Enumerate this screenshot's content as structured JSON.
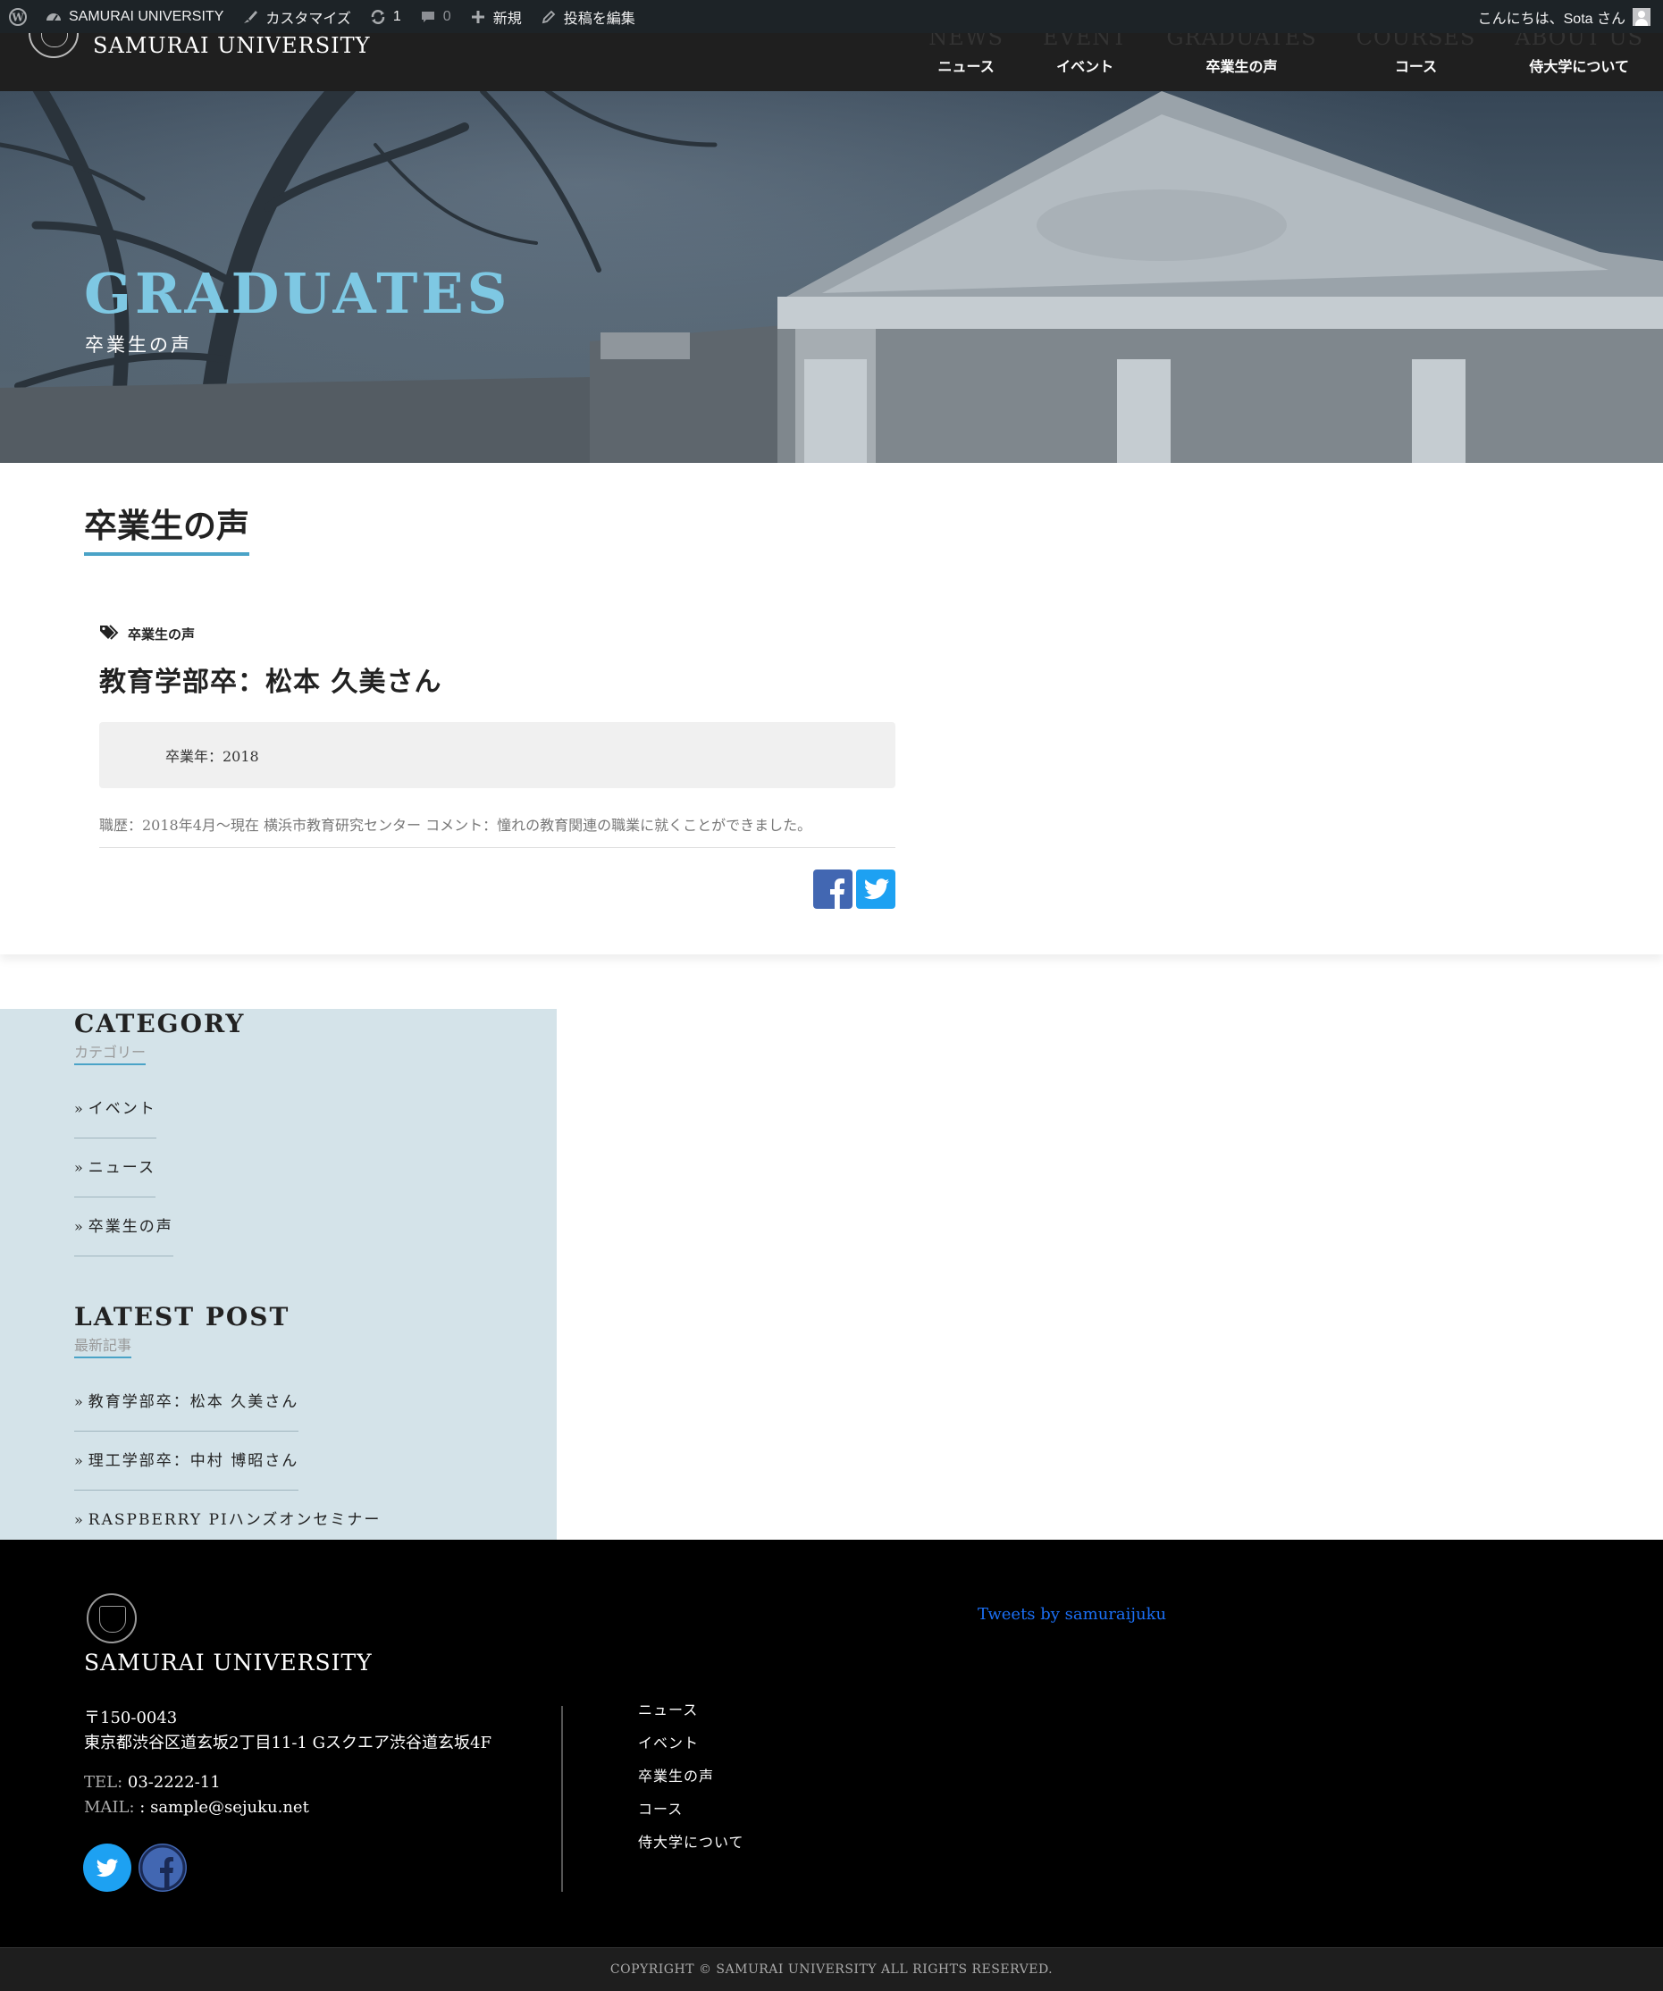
{
  "adminbar": {
    "site_label": "SAMURAI UNIVERSITY",
    "customize_label": "カスタマイズ",
    "updates_count": "1",
    "comments_count": "0",
    "new_label": "新規",
    "edit_label": "投稿を編集",
    "greeting": "こんにちは、Sota さん"
  },
  "header": {
    "site_name": "SAMURAI UNIVERSITY",
    "nav": [
      {
        "en": "NEWS",
        "ja": "ニュース"
      },
      {
        "en": "EVENT",
        "ja": "イベント"
      },
      {
        "en": "GRADUATES",
        "ja": "卒業生の声"
      },
      {
        "en": "COURSES",
        "ja": "コース"
      },
      {
        "en": "ABOUT US",
        "ja": "侍大学について"
      }
    ]
  },
  "hero": {
    "title": "GRADUATES",
    "subtitle": "卒業生の声"
  },
  "main": {
    "heading": "卒業生の声",
    "post": {
      "category": "卒業生の声",
      "title": "教育学部卒：松本 久美さん",
      "meta": "卒業年：2018",
      "body": "職歴：2018年4月～現在 横浜市教育研究センター コメント：憧れの教育関連の職業に就くことができました。"
    }
  },
  "sidebar": {
    "category": {
      "title": "CATEGORY",
      "sub": "カテゴリー",
      "items": [
        "イベント",
        "ニュース",
        "卒業生の声"
      ]
    },
    "latest": {
      "title": "LATEST POST",
      "sub": "最新記事",
      "items": [
        "教育学部卒：松本 久美さん",
        "理工学部卒：中村 博昭さん",
        "RASPBERRY PIハンズオンセミナー"
      ]
    }
  },
  "footer": {
    "site_name": "SAMURAI UNIVERSITY",
    "postal": "〒150-0043",
    "address": "東京都渋谷区道玄坂2丁目11-1 Gスクエア渋谷道玄坂4F",
    "tel_label": "TEL:",
    "tel": "03-2222-11",
    "mail_label": "MAIL:",
    "mail": ": sample@sejuku.net",
    "menu": [
      "ニュース",
      "イベント",
      "卒業生の声",
      "コース",
      "侍大学について"
    ],
    "tweets_link": "Tweets by samuraijuku",
    "copyright": "COPYRIGHT © SAMURAI UNIVERSITY ALL RIGHTS RESERVED."
  },
  "colors": {
    "accent": "#4aa3c7",
    "hero_title": "#7ec8e3",
    "sidebar_bg": "#d4e3e9",
    "facebook": "#4267b2",
    "twitter": "#1da1f2"
  }
}
